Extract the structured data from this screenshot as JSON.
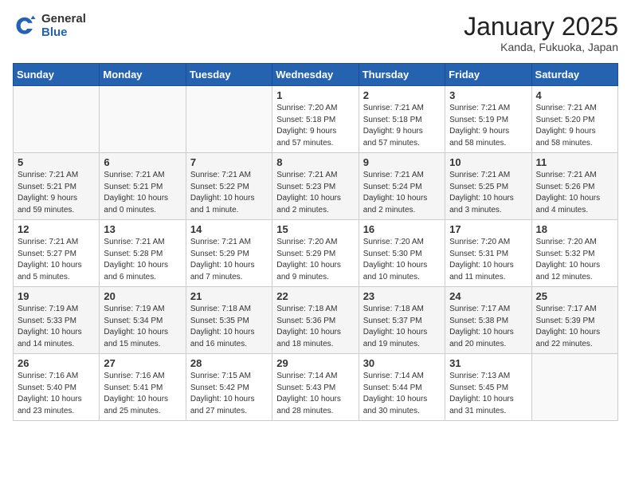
{
  "header": {
    "logo_general": "General",
    "logo_blue": "Blue",
    "month_title": "January 2025",
    "location": "Kanda, Fukuoka, Japan"
  },
  "weekdays": [
    "Sunday",
    "Monday",
    "Tuesday",
    "Wednesday",
    "Thursday",
    "Friday",
    "Saturday"
  ],
  "weeks": [
    [
      {
        "day": "",
        "info": ""
      },
      {
        "day": "",
        "info": ""
      },
      {
        "day": "",
        "info": ""
      },
      {
        "day": "1",
        "info": "Sunrise: 7:20 AM\nSunset: 5:18 PM\nDaylight: 9 hours\nand 57 minutes."
      },
      {
        "day": "2",
        "info": "Sunrise: 7:21 AM\nSunset: 5:18 PM\nDaylight: 9 hours\nand 57 minutes."
      },
      {
        "day": "3",
        "info": "Sunrise: 7:21 AM\nSunset: 5:19 PM\nDaylight: 9 hours\nand 58 minutes."
      },
      {
        "day": "4",
        "info": "Sunrise: 7:21 AM\nSunset: 5:20 PM\nDaylight: 9 hours\nand 58 minutes."
      }
    ],
    [
      {
        "day": "5",
        "info": "Sunrise: 7:21 AM\nSunset: 5:21 PM\nDaylight: 9 hours\nand 59 minutes."
      },
      {
        "day": "6",
        "info": "Sunrise: 7:21 AM\nSunset: 5:21 PM\nDaylight: 10 hours\nand 0 minutes."
      },
      {
        "day": "7",
        "info": "Sunrise: 7:21 AM\nSunset: 5:22 PM\nDaylight: 10 hours\nand 1 minute."
      },
      {
        "day": "8",
        "info": "Sunrise: 7:21 AM\nSunset: 5:23 PM\nDaylight: 10 hours\nand 2 minutes."
      },
      {
        "day": "9",
        "info": "Sunrise: 7:21 AM\nSunset: 5:24 PM\nDaylight: 10 hours\nand 2 minutes."
      },
      {
        "day": "10",
        "info": "Sunrise: 7:21 AM\nSunset: 5:25 PM\nDaylight: 10 hours\nand 3 minutes."
      },
      {
        "day": "11",
        "info": "Sunrise: 7:21 AM\nSunset: 5:26 PM\nDaylight: 10 hours\nand 4 minutes."
      }
    ],
    [
      {
        "day": "12",
        "info": "Sunrise: 7:21 AM\nSunset: 5:27 PM\nDaylight: 10 hours\nand 5 minutes."
      },
      {
        "day": "13",
        "info": "Sunrise: 7:21 AM\nSunset: 5:28 PM\nDaylight: 10 hours\nand 6 minutes."
      },
      {
        "day": "14",
        "info": "Sunrise: 7:21 AM\nSunset: 5:29 PM\nDaylight: 10 hours\nand 7 minutes."
      },
      {
        "day": "15",
        "info": "Sunrise: 7:20 AM\nSunset: 5:29 PM\nDaylight: 10 hours\nand 9 minutes."
      },
      {
        "day": "16",
        "info": "Sunrise: 7:20 AM\nSunset: 5:30 PM\nDaylight: 10 hours\nand 10 minutes."
      },
      {
        "day": "17",
        "info": "Sunrise: 7:20 AM\nSunset: 5:31 PM\nDaylight: 10 hours\nand 11 minutes."
      },
      {
        "day": "18",
        "info": "Sunrise: 7:20 AM\nSunset: 5:32 PM\nDaylight: 10 hours\nand 12 minutes."
      }
    ],
    [
      {
        "day": "19",
        "info": "Sunrise: 7:19 AM\nSunset: 5:33 PM\nDaylight: 10 hours\nand 14 minutes."
      },
      {
        "day": "20",
        "info": "Sunrise: 7:19 AM\nSunset: 5:34 PM\nDaylight: 10 hours\nand 15 minutes."
      },
      {
        "day": "21",
        "info": "Sunrise: 7:18 AM\nSunset: 5:35 PM\nDaylight: 10 hours\nand 16 minutes."
      },
      {
        "day": "22",
        "info": "Sunrise: 7:18 AM\nSunset: 5:36 PM\nDaylight: 10 hours\nand 18 minutes."
      },
      {
        "day": "23",
        "info": "Sunrise: 7:18 AM\nSunset: 5:37 PM\nDaylight: 10 hours\nand 19 minutes."
      },
      {
        "day": "24",
        "info": "Sunrise: 7:17 AM\nSunset: 5:38 PM\nDaylight: 10 hours\nand 20 minutes."
      },
      {
        "day": "25",
        "info": "Sunrise: 7:17 AM\nSunset: 5:39 PM\nDaylight: 10 hours\nand 22 minutes."
      }
    ],
    [
      {
        "day": "26",
        "info": "Sunrise: 7:16 AM\nSunset: 5:40 PM\nDaylight: 10 hours\nand 23 minutes."
      },
      {
        "day": "27",
        "info": "Sunrise: 7:16 AM\nSunset: 5:41 PM\nDaylight: 10 hours\nand 25 minutes."
      },
      {
        "day": "28",
        "info": "Sunrise: 7:15 AM\nSunset: 5:42 PM\nDaylight: 10 hours\nand 27 minutes."
      },
      {
        "day": "29",
        "info": "Sunrise: 7:14 AM\nSunset: 5:43 PM\nDaylight: 10 hours\nand 28 minutes."
      },
      {
        "day": "30",
        "info": "Sunrise: 7:14 AM\nSunset: 5:44 PM\nDaylight: 10 hours\nand 30 minutes."
      },
      {
        "day": "31",
        "info": "Sunrise: 7:13 AM\nSunset: 5:45 PM\nDaylight: 10 hours\nand 31 minutes."
      },
      {
        "day": "",
        "info": ""
      }
    ]
  ]
}
